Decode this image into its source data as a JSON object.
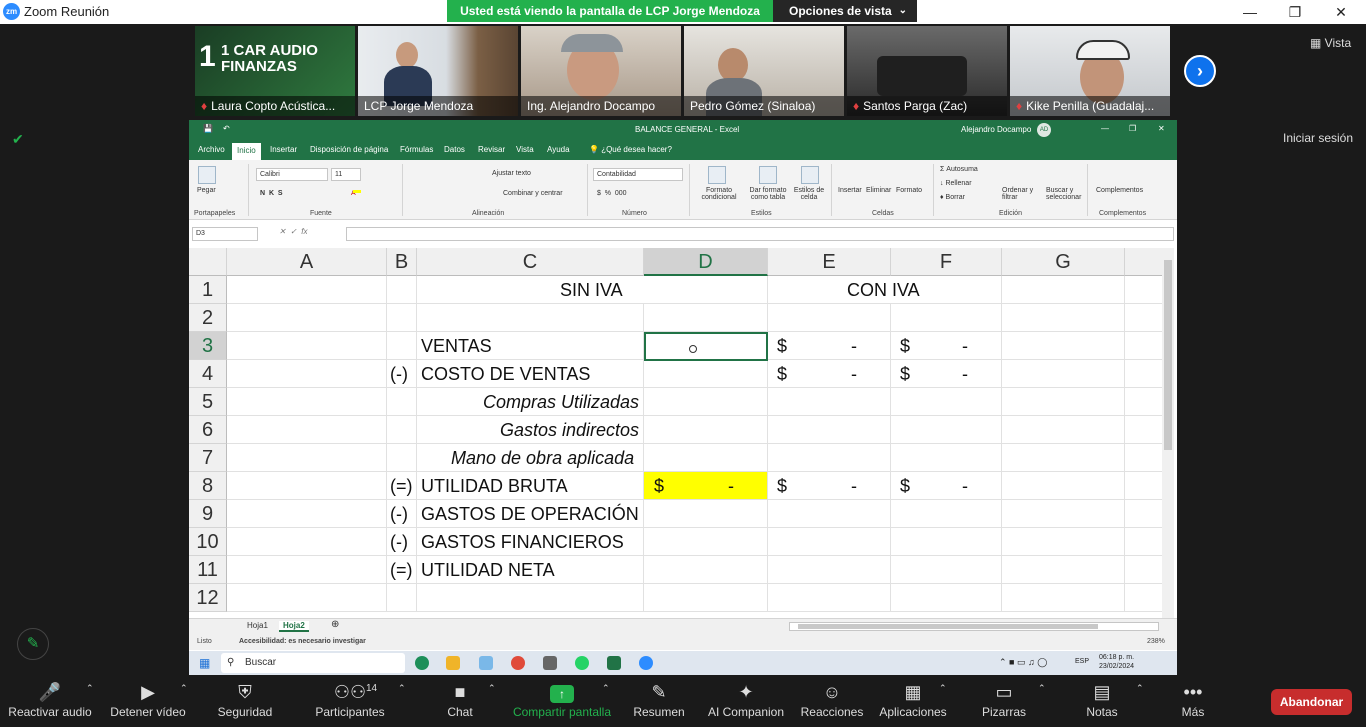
{
  "window": {
    "title": "Zoom Reunión"
  },
  "banner": {
    "sharing_text": "Usted está viendo la pantalla de LCP Jorge Mendoza",
    "view_options": "Opciones de vista"
  },
  "participants": [
    {
      "name": "Laura Copto Acústica...",
      "muted": true,
      "promo_line1": "1 CAR AUDIO",
      "promo_line2": "FINANZAS"
    },
    {
      "name": "LCP Jorge Mendoza",
      "muted": false
    },
    {
      "name": "Ing. Alejandro Docampo",
      "muted": false
    },
    {
      "name": "Pedro Gómez (Sinaloa)",
      "muted": false
    },
    {
      "name": "Santos Parga (Zac)",
      "muted": true
    },
    {
      "name": "Kike Penilla (Guadalaj...",
      "muted": true
    }
  ],
  "side": {
    "vista": "Vista",
    "signin": "Iniciar sesión"
  },
  "excel": {
    "title": "BALANCE GENERAL  -  Excel",
    "user": "Alejandro Docampo",
    "user_initials": "AD",
    "tabs": [
      "Archivo",
      "Inicio",
      "Insertar",
      "Disposición de página",
      "Fórmulas",
      "Datos",
      "Revisar",
      "Vista",
      "Ayuda",
      "¿Qué desea hacer?"
    ],
    "ribbon": {
      "paste": "Pegar",
      "font_name": "Calibri",
      "font_size": "11",
      "wrap_text": "Ajustar texto",
      "merge": "Combinar y centrar",
      "number_format": "Contabilidad",
      "cond_format": "Formato condicional",
      "table_format": "Dar formato como tabla",
      "cell_styles": "Estilos de celda",
      "insert": "Insertar",
      "delete": "Eliminar",
      "format": "Formato",
      "autosum": "Autosuma",
      "fill": "Rellenar",
      "clear": "Borrar",
      "sort": "Ordenar y filtrar",
      "find": "Buscar y seleccionar",
      "addins": "Complementos",
      "groups": [
        "Portapapeles",
        "Fuente",
        "Alineación",
        "Número",
        "Estilos",
        "Celdas",
        "Edición",
        "Complementos"
      ]
    },
    "name_box": "D3",
    "columns": [
      "A",
      "B",
      "C",
      "D",
      "E",
      "F",
      "G"
    ],
    "rows": [
      "1",
      "2",
      "3",
      "4",
      "5",
      "6",
      "7",
      "8",
      "9",
      "10",
      "11",
      "12"
    ],
    "cells": {
      "c1": "SIN IVA",
      "e1": "CON IVA",
      "b4": "(-)",
      "c3": "VENTAS",
      "c4": "COSTO DE VENTAS",
      "c5": "Compras Utilizadas",
      "c6": "Gastos indirectos",
      "c7": "Mano de obra aplicada",
      "b8": "(=)",
      "c8": "UTILIDAD BRUTA",
      "b9": "(-)",
      "c9": "GASTOS DE OPERACIÓN",
      "b10": "(-)",
      "c10": "GASTOS FINANCIEROS",
      "b11": "(=)",
      "c11": "UTILIDAD NETA",
      "currency": "$",
      "dash": "-"
    },
    "sheets": [
      "Hoja1",
      "Hoja2"
    ],
    "status": {
      "ready": "Listo",
      "accessibility": "Accesibilidad: es necesario investigar",
      "zoom": "238%"
    },
    "taskbar": {
      "search": "Buscar",
      "lang": "ESP",
      "time": "06:18 p. m.",
      "date": "23/02/2024"
    }
  },
  "toolbar": {
    "audio": "Reactivar audio",
    "video": "Detener vídeo",
    "security": "Seguridad",
    "participants": "Participantes",
    "participants_count": "14",
    "chat": "Chat",
    "share": "Compartir pantalla",
    "summary": "Resumen",
    "companion": "AI Companion",
    "reactions": "Reacciones",
    "apps": "Aplicaciones",
    "whiteboards": "Pizarras",
    "notes": "Notas",
    "more": "Más",
    "leave": "Abandonar"
  },
  "colors": {
    "zoom_blue": "#2d8cff",
    "share_green": "#23b14d",
    "excel_green": "#217346",
    "leave_red": "#c72d2d",
    "highlight_yellow": "#ffff00"
  }
}
